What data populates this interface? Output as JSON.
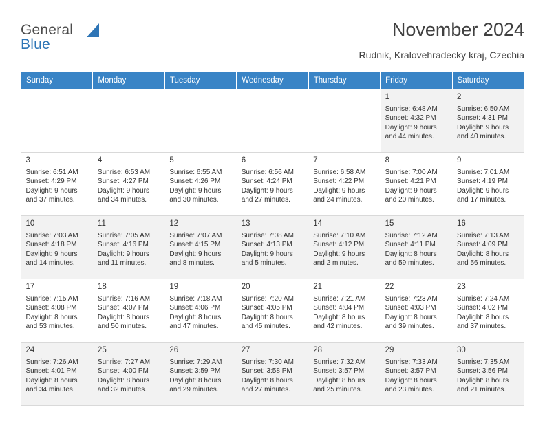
{
  "brand": {
    "line1": "General",
    "line2": "Blue"
  },
  "header": {
    "title": "November 2024",
    "location": "Rudnik, Kralovehradecky kraj, Czechia"
  },
  "weekdays": [
    "Sunday",
    "Monday",
    "Tuesday",
    "Wednesday",
    "Thursday",
    "Friday",
    "Saturday"
  ],
  "colors": {
    "header_bg": "#3984c6",
    "shaded_row": "#f2f2f2",
    "text": "#333333",
    "brand_blue": "#2e75b6"
  },
  "weeks": [
    {
      "shaded": true,
      "days": [
        {
          "empty": true
        },
        {
          "empty": true
        },
        {
          "empty": true
        },
        {
          "empty": true
        },
        {
          "empty": true
        },
        {
          "num": "1",
          "lines": [
            "Sunrise: 6:48 AM",
            "Sunset: 4:32 PM",
            "Daylight: 9 hours",
            "and 44 minutes."
          ]
        },
        {
          "num": "2",
          "lines": [
            "Sunrise: 6:50 AM",
            "Sunset: 4:31 PM",
            "Daylight: 9 hours",
            "and 40 minutes."
          ]
        }
      ]
    },
    {
      "shaded": false,
      "days": [
        {
          "num": "3",
          "lines": [
            "Sunrise: 6:51 AM",
            "Sunset: 4:29 PM",
            "Daylight: 9 hours",
            "and 37 minutes."
          ]
        },
        {
          "num": "4",
          "lines": [
            "Sunrise: 6:53 AM",
            "Sunset: 4:27 PM",
            "Daylight: 9 hours",
            "and 34 minutes."
          ]
        },
        {
          "num": "5",
          "lines": [
            "Sunrise: 6:55 AM",
            "Sunset: 4:26 PM",
            "Daylight: 9 hours",
            "and 30 minutes."
          ]
        },
        {
          "num": "6",
          "lines": [
            "Sunrise: 6:56 AM",
            "Sunset: 4:24 PM",
            "Daylight: 9 hours",
            "and 27 minutes."
          ]
        },
        {
          "num": "7",
          "lines": [
            "Sunrise: 6:58 AM",
            "Sunset: 4:22 PM",
            "Daylight: 9 hours",
            "and 24 minutes."
          ]
        },
        {
          "num": "8",
          "lines": [
            "Sunrise: 7:00 AM",
            "Sunset: 4:21 PM",
            "Daylight: 9 hours",
            "and 20 minutes."
          ]
        },
        {
          "num": "9",
          "lines": [
            "Sunrise: 7:01 AM",
            "Sunset: 4:19 PM",
            "Daylight: 9 hours",
            "and 17 minutes."
          ]
        }
      ]
    },
    {
      "shaded": true,
      "days": [
        {
          "num": "10",
          "lines": [
            "Sunrise: 7:03 AM",
            "Sunset: 4:18 PM",
            "Daylight: 9 hours",
            "and 14 minutes."
          ]
        },
        {
          "num": "11",
          "lines": [
            "Sunrise: 7:05 AM",
            "Sunset: 4:16 PM",
            "Daylight: 9 hours",
            "and 11 minutes."
          ]
        },
        {
          "num": "12",
          "lines": [
            "Sunrise: 7:07 AM",
            "Sunset: 4:15 PM",
            "Daylight: 9 hours",
            "and 8 minutes."
          ]
        },
        {
          "num": "13",
          "lines": [
            "Sunrise: 7:08 AM",
            "Sunset: 4:13 PM",
            "Daylight: 9 hours",
            "and 5 minutes."
          ]
        },
        {
          "num": "14",
          "lines": [
            "Sunrise: 7:10 AM",
            "Sunset: 4:12 PM",
            "Daylight: 9 hours",
            "and 2 minutes."
          ]
        },
        {
          "num": "15",
          "lines": [
            "Sunrise: 7:12 AM",
            "Sunset: 4:11 PM",
            "Daylight: 8 hours",
            "and 59 minutes."
          ]
        },
        {
          "num": "16",
          "lines": [
            "Sunrise: 7:13 AM",
            "Sunset: 4:09 PM",
            "Daylight: 8 hours",
            "and 56 minutes."
          ]
        }
      ]
    },
    {
      "shaded": false,
      "days": [
        {
          "num": "17",
          "lines": [
            "Sunrise: 7:15 AM",
            "Sunset: 4:08 PM",
            "Daylight: 8 hours",
            "and 53 minutes."
          ]
        },
        {
          "num": "18",
          "lines": [
            "Sunrise: 7:16 AM",
            "Sunset: 4:07 PM",
            "Daylight: 8 hours",
            "and 50 minutes."
          ]
        },
        {
          "num": "19",
          "lines": [
            "Sunrise: 7:18 AM",
            "Sunset: 4:06 PM",
            "Daylight: 8 hours",
            "and 47 minutes."
          ]
        },
        {
          "num": "20",
          "lines": [
            "Sunrise: 7:20 AM",
            "Sunset: 4:05 PM",
            "Daylight: 8 hours",
            "and 45 minutes."
          ]
        },
        {
          "num": "21",
          "lines": [
            "Sunrise: 7:21 AM",
            "Sunset: 4:04 PM",
            "Daylight: 8 hours",
            "and 42 minutes."
          ]
        },
        {
          "num": "22",
          "lines": [
            "Sunrise: 7:23 AM",
            "Sunset: 4:03 PM",
            "Daylight: 8 hours",
            "and 39 minutes."
          ]
        },
        {
          "num": "23",
          "lines": [
            "Sunrise: 7:24 AM",
            "Sunset: 4:02 PM",
            "Daylight: 8 hours",
            "and 37 minutes."
          ]
        }
      ]
    },
    {
      "shaded": true,
      "days": [
        {
          "num": "24",
          "lines": [
            "Sunrise: 7:26 AM",
            "Sunset: 4:01 PM",
            "Daylight: 8 hours",
            "and 34 minutes."
          ]
        },
        {
          "num": "25",
          "lines": [
            "Sunrise: 7:27 AM",
            "Sunset: 4:00 PM",
            "Daylight: 8 hours",
            "and 32 minutes."
          ]
        },
        {
          "num": "26",
          "lines": [
            "Sunrise: 7:29 AM",
            "Sunset: 3:59 PM",
            "Daylight: 8 hours",
            "and 29 minutes."
          ]
        },
        {
          "num": "27",
          "lines": [
            "Sunrise: 7:30 AM",
            "Sunset: 3:58 PM",
            "Daylight: 8 hours",
            "and 27 minutes."
          ]
        },
        {
          "num": "28",
          "lines": [
            "Sunrise: 7:32 AM",
            "Sunset: 3:57 PM",
            "Daylight: 8 hours",
            "and 25 minutes."
          ]
        },
        {
          "num": "29",
          "lines": [
            "Sunrise: 7:33 AM",
            "Sunset: 3:57 PM",
            "Daylight: 8 hours",
            "and 23 minutes."
          ]
        },
        {
          "num": "30",
          "lines": [
            "Sunrise: 7:35 AM",
            "Sunset: 3:56 PM",
            "Daylight: 8 hours",
            "and 21 minutes."
          ]
        }
      ]
    }
  ]
}
